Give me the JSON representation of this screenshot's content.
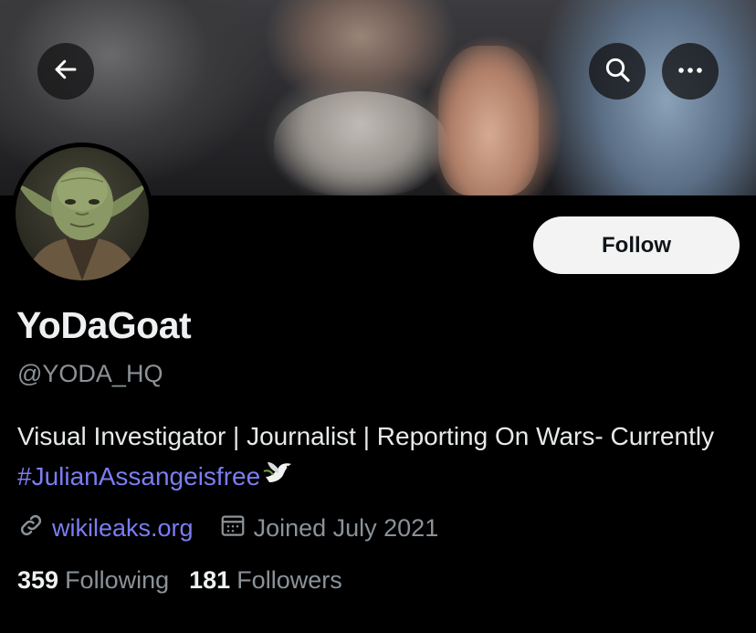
{
  "header": {
    "back_icon": "arrow-left-icon",
    "search_icon": "search-icon",
    "more_icon": "more-horizontal-icon"
  },
  "profile": {
    "display_name": "YoDaGoat",
    "handle": "@YODA_HQ",
    "follow_label": "Follow",
    "bio_text": "Visual Investigator | Journalist | Reporting On Wars- Currently ",
    "bio_hashtag": "#JulianAssangeisfree",
    "bio_emoji": "dove-icon",
    "website": "wikileaks.org",
    "joined": "Joined July 2021",
    "following_count": "359",
    "following_label": "Following",
    "followers_count": "181",
    "followers_label": "Followers"
  },
  "colors": {
    "background": "#000000",
    "accent_link": "#7b7df2",
    "muted_text": "#8b9298",
    "follow_button_bg": "#f3f3f3"
  }
}
